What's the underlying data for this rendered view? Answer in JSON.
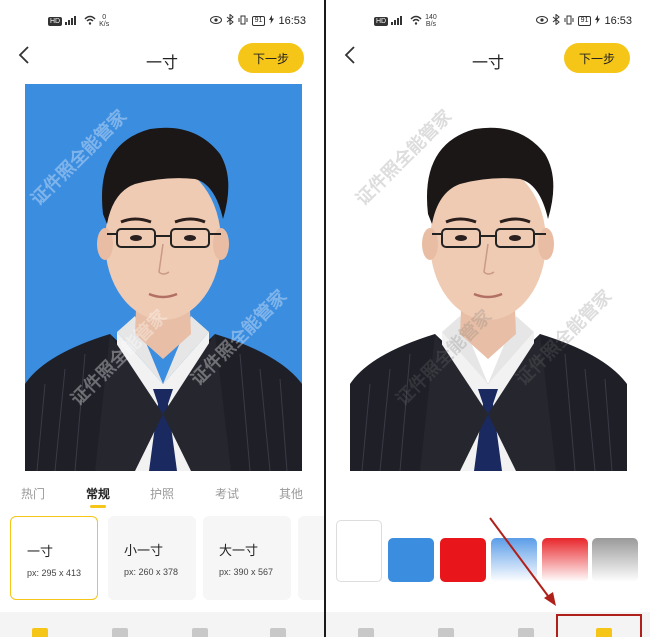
{
  "status": {
    "time": "16:53",
    "battery": "91",
    "left_speed_value": "0",
    "right_speed_value": "140",
    "left_speed_unit": "K/s",
    "right_speed_unit": "B/s",
    "network": "HD"
  },
  "header": {
    "back": "<",
    "title": "一寸",
    "next_label": "下一步"
  },
  "watermark": [
    "证件照全能管家",
    "证件照全能管家",
    "证件照全能管家"
  ],
  "category_tabs": [
    "热门",
    "常规",
    "护照",
    "考试",
    "其他"
  ],
  "active_tab_index": 1,
  "sizes": [
    {
      "name": "一寸",
      "px": "px: 295 x 413",
      "selected": true
    },
    {
      "name": "小一寸",
      "px": "px: 260 x 378",
      "selected": false
    },
    {
      "name": "大一寸",
      "px": "px: 390 x 567",
      "selected": false
    }
  ],
  "background_colors": [
    {
      "name": "white",
      "value": "#ffffff"
    },
    {
      "name": "blue",
      "value": "#3b8de0"
    },
    {
      "name": "red",
      "value": "#e8161b"
    },
    {
      "name": "blue-gradient",
      "value": "#5b9de8"
    },
    {
      "name": "red-gradient",
      "value": "#e8262b"
    },
    {
      "name": "gray-gradient",
      "value": "#9a9a9a"
    }
  ],
  "bottom_tools": [
    "size-tool",
    "clothes-tool",
    "beauty-tool",
    "background-tool"
  ],
  "colors": {
    "accent": "#f5c518",
    "photo_blue": "#3b8de0",
    "highlight_red": "#b0201a"
  }
}
